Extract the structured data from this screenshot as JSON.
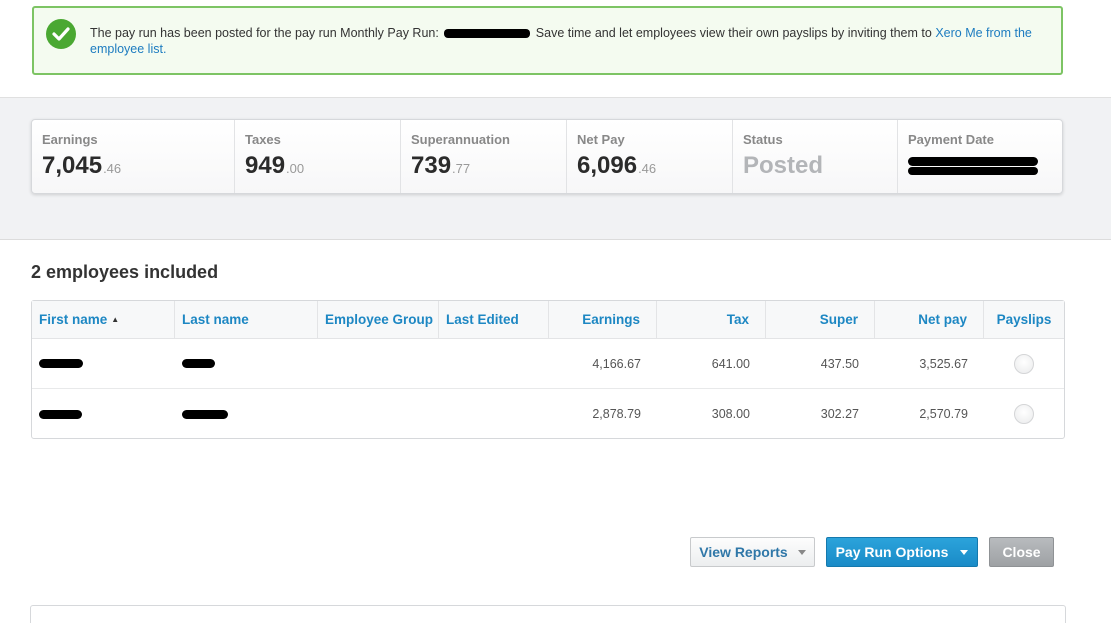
{
  "banner": {
    "message_prefix": "The pay run has been posted for the pay run Monthly Pay Run:",
    "message_suffix": "Save time and let employees view their own payslips by inviting them to",
    "link_text": "Xero Me from the employee list."
  },
  "summary": {
    "earnings": {
      "label": "Earnings",
      "main": "7,045",
      "dec": ".46"
    },
    "taxes": {
      "label": "Taxes",
      "main": "949",
      "dec": ".00"
    },
    "super": {
      "label": "Superannuation",
      "main": "739",
      "dec": ".77"
    },
    "net_pay": {
      "label": "Net Pay",
      "main": "6,096",
      "dec": ".46"
    },
    "status": {
      "label": "Status",
      "value": "Posted"
    },
    "payment_date": {
      "label": "Payment Date"
    }
  },
  "employees": {
    "title": "2 employees included",
    "columns": [
      "First name",
      "Last name",
      "Employee Group",
      "Last Edited",
      "Earnings",
      "Tax",
      "Super",
      "Net pay",
      "Payslips"
    ],
    "rows": [
      {
        "earnings": "4,166.67",
        "tax": "641.00",
        "super": "437.50",
        "net_pay": "3,525.67"
      },
      {
        "earnings": "2,878.79",
        "tax": "308.00",
        "super": "302.27",
        "net_pay": "2,570.79"
      }
    ]
  },
  "footer": {
    "view_reports": "View Reports",
    "pay_run_options": "Pay Run Options",
    "close": "Close"
  },
  "colors": {
    "accent": "#1d87c3",
    "success": "#4aa832",
    "primary_button": "#1a8bc7"
  }
}
